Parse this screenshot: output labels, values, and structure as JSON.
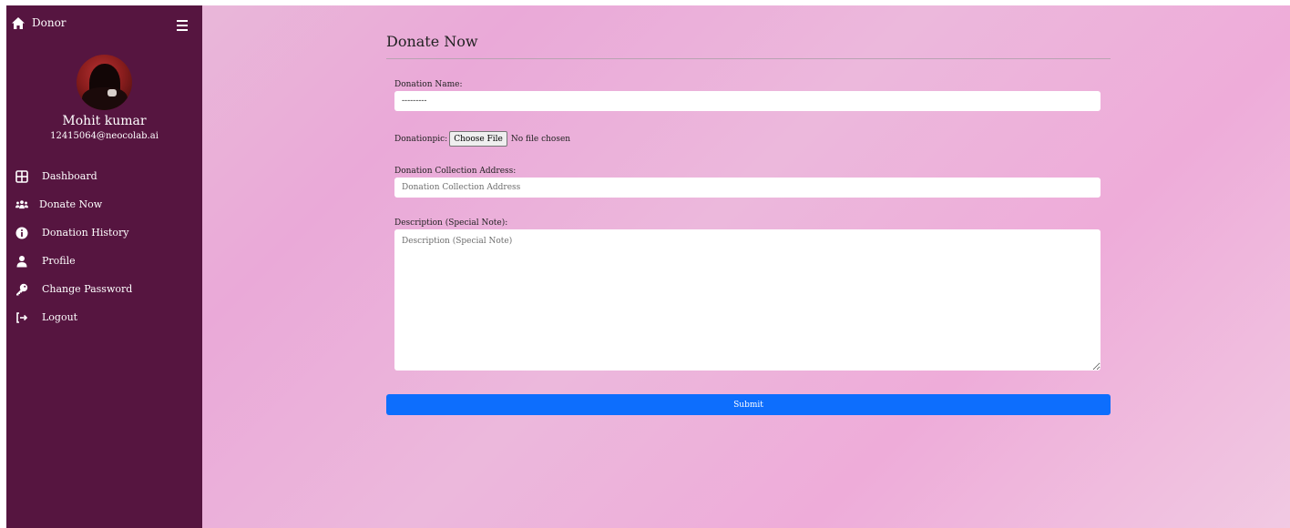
{
  "sidebar": {
    "brand": "Donor",
    "user": {
      "name": "Mohit kumar",
      "email": "12415064@neocolab.ai"
    },
    "items": [
      {
        "label": "Dashboard",
        "icon": "grid-icon"
      },
      {
        "label": "Donate Now",
        "icon": "users-icon"
      },
      {
        "label": "Donation History",
        "icon": "info-icon"
      },
      {
        "label": "Profile",
        "icon": "user-icon"
      },
      {
        "label": "Change Password",
        "icon": "key-icon"
      },
      {
        "label": "Logout",
        "icon": "logout-icon"
      }
    ]
  },
  "form": {
    "title": "Donate Now",
    "donation_name": {
      "label": "Donation Name:",
      "value": "---------"
    },
    "donation_pic": {
      "label": "Donationpic:",
      "button": "Choose File",
      "status": "No file chosen"
    },
    "address": {
      "label": "Donation Collection Address:",
      "placeholder": "Donation Collection Address"
    },
    "description": {
      "label": "Description (Special Note):",
      "placeholder": "Description (Special Note)"
    },
    "submit": "Submit"
  },
  "colors": {
    "sidebar_bg": "#561540",
    "primary": "#0d6efd",
    "main_bg": "#eaa9d8"
  }
}
